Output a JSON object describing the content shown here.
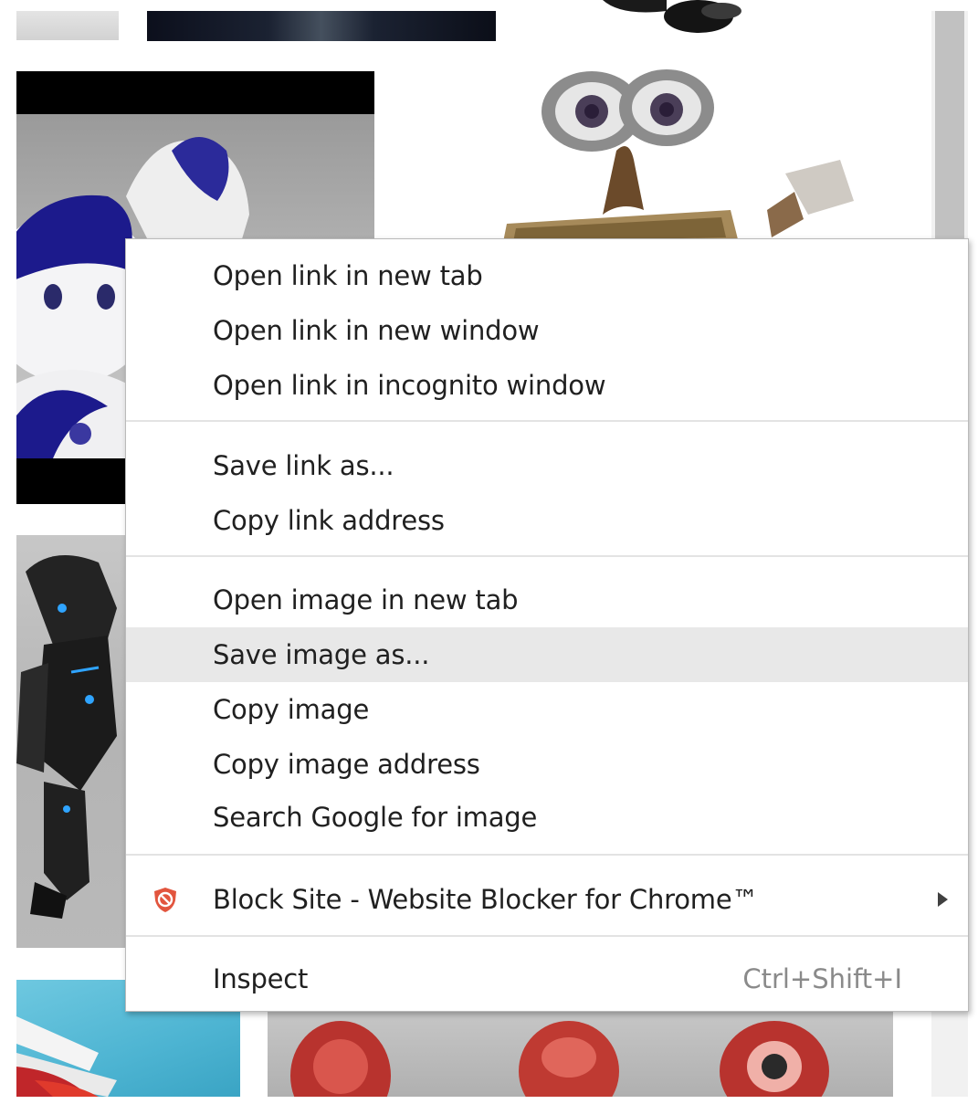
{
  "background_thumbnails": [
    {
      "name": "top-left"
    },
    {
      "name": "top-middle"
    },
    {
      "name": "top-right"
    },
    {
      "name": "nao-robot"
    },
    {
      "name": "wall-e-robot"
    },
    {
      "name": "dark-armored-robot"
    },
    {
      "name": "bottom-left"
    },
    {
      "name": "bottom-red-robots"
    }
  ],
  "context_menu": {
    "items": [
      {
        "label": "Open link in new tab"
      },
      {
        "label": "Open link in new window"
      },
      {
        "label": "Open link in incognito window"
      },
      {
        "label": "Save link as..."
      },
      {
        "label": "Copy link address"
      },
      {
        "label": "Open image in new tab"
      },
      {
        "label": "Save image as...",
        "highlighted": true
      },
      {
        "label": "Copy image"
      },
      {
        "label": "Copy image address"
      },
      {
        "label": "Search Google for image"
      },
      {
        "label": "Block Site - Website Blocker for Chrome™",
        "icon": "block-site-shield-icon",
        "has_submenu": true
      },
      {
        "label": "Inspect",
        "shortcut": "Ctrl+Shift+I"
      }
    ]
  },
  "colors": {
    "highlight": "#e8e8e8",
    "block_site_icon": "#e2553e",
    "scrollbar_thumb": "#c1c1c1"
  }
}
